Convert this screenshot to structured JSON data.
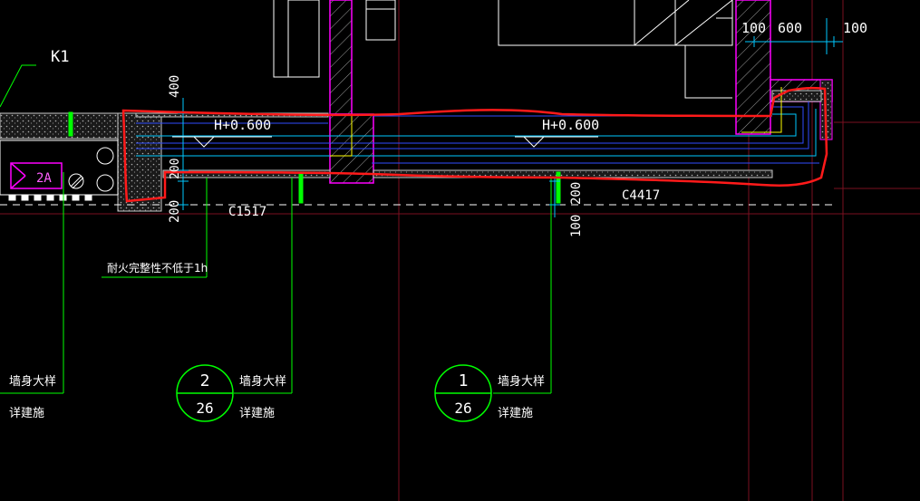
{
  "colors": {
    "background": "#000000",
    "wall_outline": "#ff00ff",
    "leader": "#00ff00",
    "pipe_blue": "#2f4cff",
    "pipe_cyan": "#00c8ff",
    "markup": "#ff1010",
    "grid": "#7a1020",
    "hatch": "#a8a8a8",
    "text": "#ffffff"
  },
  "labels": {
    "k1": "K1",
    "tag_2a": "2A",
    "elev_left": "H+0.600",
    "elev_right": "H+0.600",
    "window_left": "C1517",
    "window_right": "C4417",
    "fire_note": "耐火完整性不低于1h"
  },
  "dimensions": {
    "d_top_100a": "100",
    "d_top_600": "600",
    "d_top_100b": "100",
    "d_400": "400",
    "d_200_mid": "200",
    "d_200_low": "200",
    "d_200_right": "200",
    "d_100_right": "100"
  },
  "callouts": {
    "c2_num": "2",
    "c2_sheet": "26",
    "c1_num": "1",
    "c1_sheet": "26",
    "wall_detail": "墙身大样",
    "see_arch": "详建施"
  }
}
